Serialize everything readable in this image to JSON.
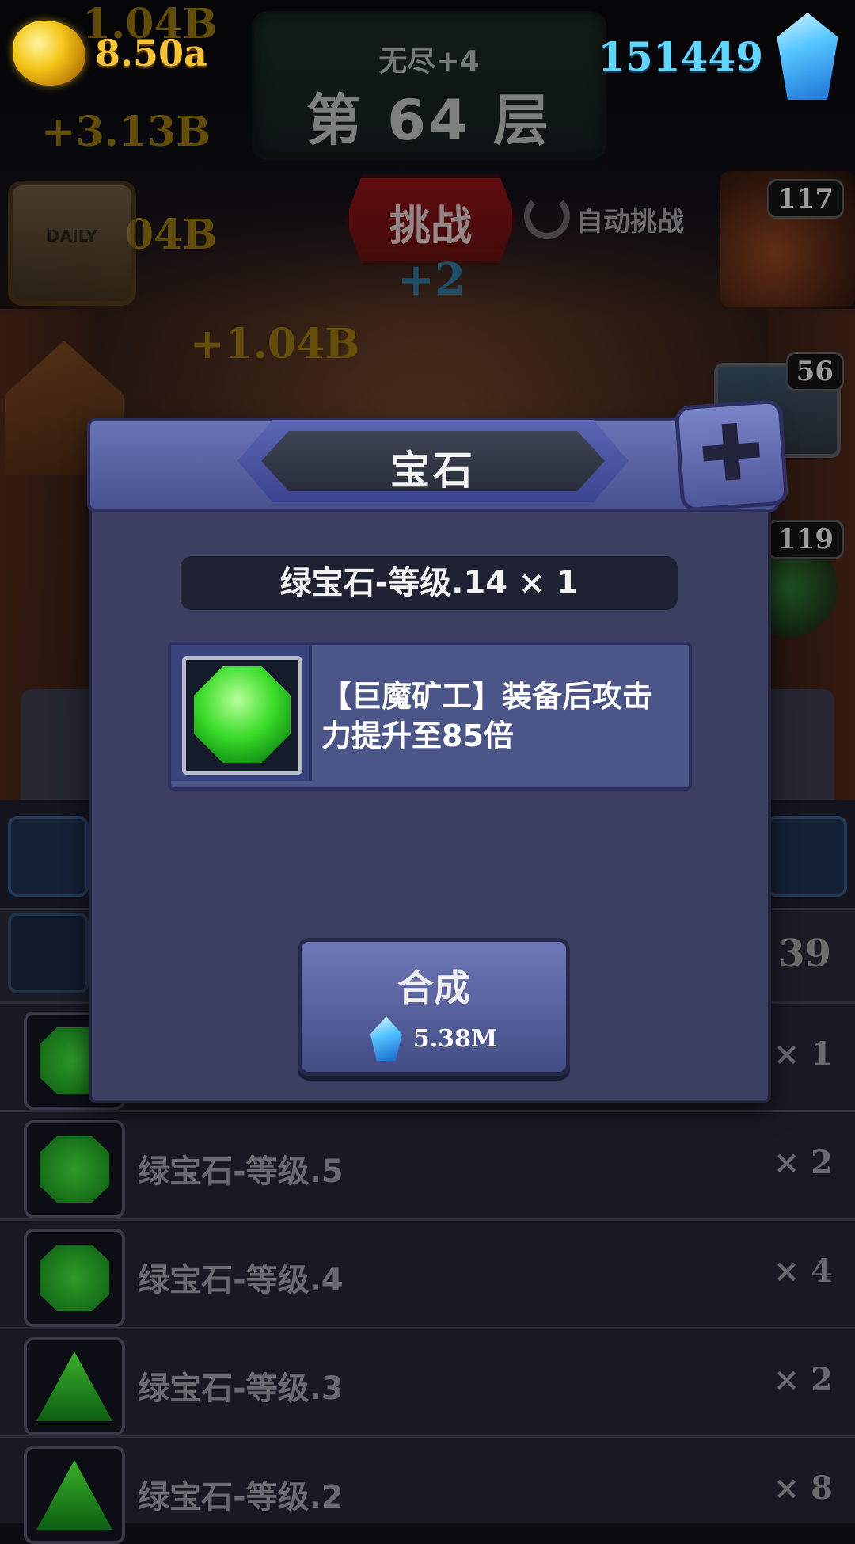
{
  "hud": {
    "gold": "8.50a",
    "gems": "151449",
    "floor_sub": "无尽+4",
    "floor_main": "第 64 层",
    "challenge_label": "挑战",
    "auto_label": "自动挑战",
    "plus_two": "+2"
  },
  "floating_numbers": [
    "1.04B",
    "+3.13B",
    "04B",
    "+1.04B"
  ],
  "calendar_label": "DAILY",
  "badges": {
    "dwarf": "117",
    "chest": "56",
    "ore": "119"
  },
  "modal": {
    "title": "宝石",
    "item_banner": "绿宝石-等级.14  × 1",
    "description": "【巨魔矿工】装备后攻击力提升至85倍",
    "synth_label": "合成",
    "synth_cost": "5.38M"
  },
  "list": {
    "count": "39",
    "rows": [
      {
        "name": "",
        "qty": "× 1",
        "shape": "sq"
      },
      {
        "name": "绿宝石-等级.5",
        "qty": "× 2",
        "shape": "sq"
      },
      {
        "name": "绿宝石-等级.4",
        "qty": "× 4",
        "shape": "sq"
      },
      {
        "name": "绿宝石-等级.3",
        "qty": "× 2",
        "shape": "tri"
      },
      {
        "name": "绿宝石-等级.2",
        "qty": "× 8",
        "shape": "tri"
      }
    ]
  }
}
